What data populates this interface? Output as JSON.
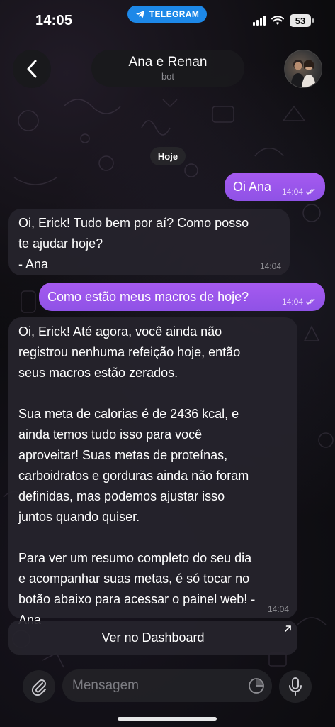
{
  "status_bar": {
    "time": "14:05",
    "app_pill": "TELEGRAM",
    "battery": "53"
  },
  "header": {
    "title": "Ana e Renan",
    "subtitle": "bot"
  },
  "date_chip": "Hoje",
  "messages": [
    {
      "side": "out",
      "text": "Oi Ana",
      "time": "14:04",
      "read": true
    },
    {
      "side": "in",
      "text": "Oi, Erick! Tudo bem por aí? Como posso\nte ajudar hoje?\n- Ana",
      "time": "14:04"
    },
    {
      "side": "out",
      "text": "Como estão meus macros de hoje?",
      "time": "14:04",
      "read": true
    },
    {
      "side": "in",
      "text": "Oi, Erick! Até agora, você ainda não\nregistrou nenhuma refeição hoje, então\nseus macros estão zerados.\n\nSua meta de calorias é de 2436 kcal, e\nainda temos tudo isso para você\naproveitar! Suas metas de proteínas,\ncarboidratos e gorduras ainda não foram\ndefinidas, mas podemos ajustar isso\njuntos quando quiser.\n\nPara ver um resumo completo do seu dia\ne acompanhar suas metas, é só tocar no\nbotão abaixo para acessar o painel web! -\nAna",
      "time": "14:04"
    }
  ],
  "dashboard_button": "Ver no Dashboard",
  "composer": {
    "placeholder": "Mensagem"
  },
  "colors": {
    "outgoing_bubble": "#9d57ee",
    "incoming_bubble": "#26242c",
    "telegram_pill": "#1d88e8"
  }
}
